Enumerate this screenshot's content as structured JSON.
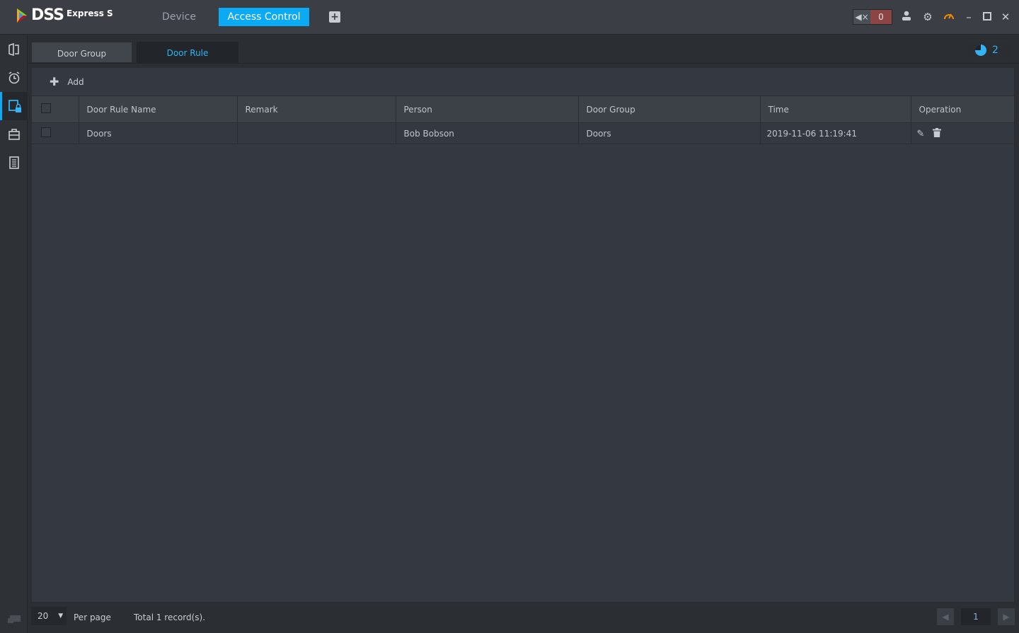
{
  "app": {
    "logo_text": "DSS",
    "logo_sub": "Express S"
  },
  "nav": {
    "device": "Device",
    "access_control": "Access Control"
  },
  "alarm": {
    "count": "0"
  },
  "tabs": {
    "door_group": "Door Group",
    "door_rule": "Door Rule"
  },
  "badge": {
    "count": "2"
  },
  "toolbar": {
    "add": "Add"
  },
  "table": {
    "headers": [
      "Door Rule Name",
      "Remark",
      "Person",
      "Door Group",
      "Time",
      "Operation"
    ],
    "rows": [
      {
        "name": "Doors",
        "remark": "",
        "person": "Bob Bobson",
        "door_group": "Doors",
        "time": "2019-11-06 11:19:41"
      }
    ]
  },
  "footer": {
    "per_page_value": "20",
    "per_page_label": "Per page",
    "total": "Total 1 record(s).",
    "page": "1"
  },
  "colors": {
    "accent": "#0aaaf5",
    "alarm": "#8b4542",
    "speed": "#f08a00"
  }
}
